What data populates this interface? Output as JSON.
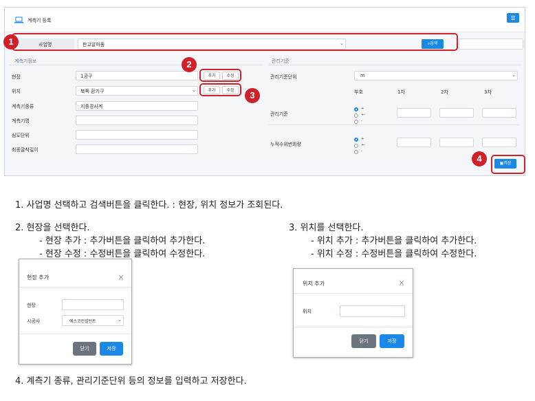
{
  "screen": {
    "title": "계측기 등록",
    "business_label": "사업명",
    "business_value": "판교알파돔",
    "search_label": "검색",
    "info_section": "계측기정보",
    "criteria_section": "관리기준",
    "fields": [
      "현장",
      "위치",
      "계측기종류",
      "계측기명",
      "심도단위",
      "최종굴착깊이"
    ],
    "site_value": "1공구",
    "location_value": "북쪽 환기구",
    "type_value": "지중경사계",
    "add_label": "추가",
    "edit_label": "수정",
    "criteria_unit_label": "관리기준단위",
    "criteria_unit_value": "m",
    "col_headers": [
      "부호",
      "1차",
      "2차",
      "3차"
    ],
    "criteria_label": "관리기준",
    "cumulative_label": "누적수위변화량",
    "signs": [
      "+",
      "+-",
      "-"
    ],
    "save_label": "저장",
    "badges": [
      "1",
      "2",
      "3",
      "4"
    ]
  },
  "instructions": {
    "step1": "1. 사업명 선택하고 검색버튼을 클릭한다. : 현장, 위치 정보가 조회된다.",
    "step2": "2. 현장을 선택한다.",
    "step2a": "- 현장 추가 : 추가버튼을 클릭하여 추가한다.",
    "step2b": "- 현장 수정 : 수정버튼을 클릭하여 수정한다.",
    "step3": "3. 위치를 선택한다.",
    "step3a": "- 위치 추가 : 추가버튼을 클릭하여 추가한다.",
    "step3b": "- 위치 수정 : 수정버튼을 클릭하여 수정한다.",
    "step4": "4. 계측기 종류, 관리기준단위 등의 정보를 입력하고 저장한다."
  },
  "dialog_site": {
    "title": "현장 추가",
    "field1": "현장",
    "field2": "시공사",
    "field2_value": "에스코컨설턴트",
    "close_label": "닫기",
    "save_label": "저장"
  },
  "dialog_location": {
    "title": "위치 추가",
    "field1": "위치",
    "close_label": "닫기",
    "save_label": "저장"
  }
}
